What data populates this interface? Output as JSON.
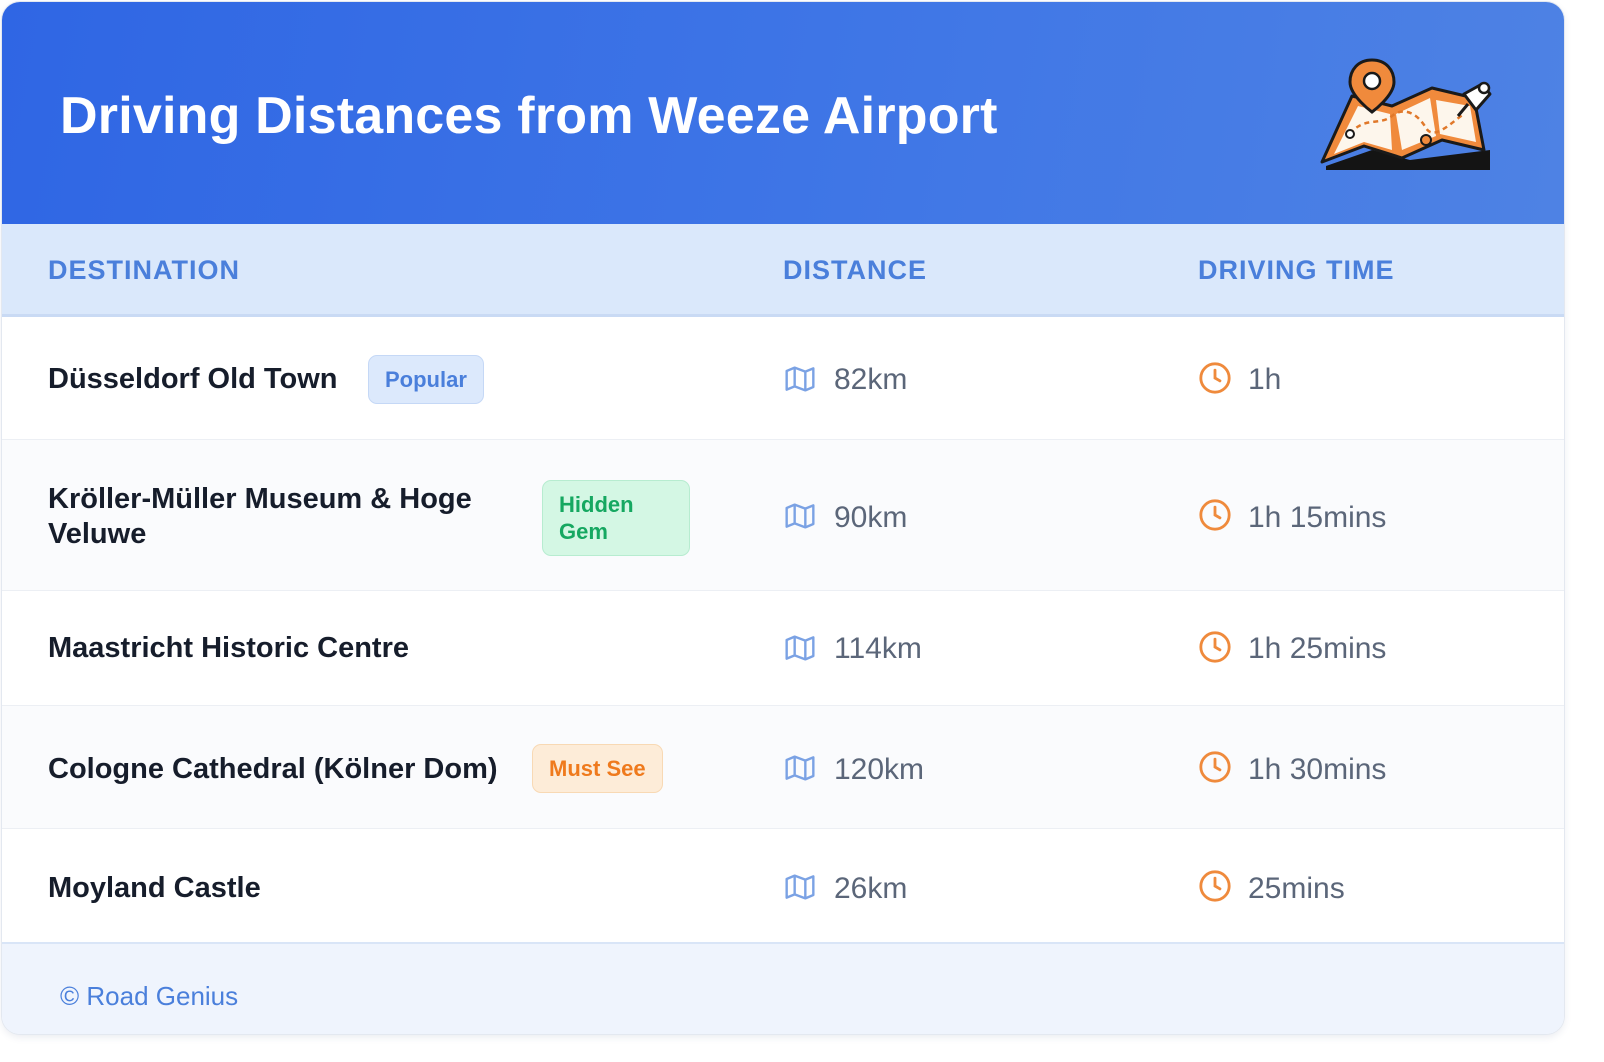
{
  "header": {
    "title": "Driving Distances from Weeze Airport",
    "illustration": "folded-map-with-location-pin"
  },
  "table": {
    "columns": [
      "DESTINATION",
      "DISTANCE",
      "DRIVING TIME"
    ],
    "distance_icon": "map-icon",
    "time_icon": "clock-icon",
    "rows": [
      {
        "destination": "Düsseldorf Old Town",
        "badge": "Popular",
        "badge_type": "popular",
        "distance": "82km",
        "time": "1h"
      },
      {
        "destination": "Kröller-Müller Museum & Hoge Veluwe",
        "badge": "Hidden Gem",
        "badge_type": "hidden-gem",
        "distance": "90km",
        "time": "1h 15mins"
      },
      {
        "destination": "Maastricht Historic Centre",
        "badge": "",
        "badge_type": "",
        "distance": "114km",
        "time": "1h 25mins"
      },
      {
        "destination": "Cologne Cathedral (Kölner Dom)",
        "badge": "Must See",
        "badge_type": "must-see",
        "distance": "120km",
        "time": "1h 30mins"
      },
      {
        "destination": "Moyland Castle",
        "badge": "",
        "badge_type": "",
        "distance": "26km",
        "time": "25mins"
      }
    ]
  },
  "footer": {
    "credit": "© Road Genius"
  },
  "colors": {
    "header_gradient": [
      "#2f66e4",
      "#4e82e4"
    ],
    "accent_blue": "#4a7fdb",
    "icon_orange": "#ef8a3c",
    "badge_green": "#16a861",
    "badge_orange": "#ef7a1d"
  }
}
